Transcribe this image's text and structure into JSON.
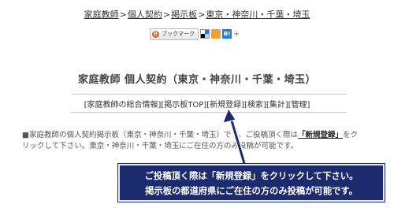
{
  "breadcrumb": {
    "items": [
      "家庭教師",
      "個人契約",
      "掲示板",
      "東京・神奈川・千葉・埼玉"
    ],
    "separator": ">"
  },
  "social": {
    "bookmark_label": "ブックマーク",
    "hatena_label": "B!",
    "plus_label": "+"
  },
  "page": {
    "title": "家庭教師 個人契約（東京・神奈川・千葉・埼玉）"
  },
  "menu": {
    "items": [
      "[家庭教師の総合情報]",
      "[掲示板TOP]",
      "[新規登録]",
      "[検索]",
      "[集計]",
      "[管理]"
    ]
  },
  "description": {
    "line1_pre": "■家庭教師の個人契約掲示板（東京・神奈川・千葉・埼玉）です。ご投稿頂く際は",
    "register_link": "「新規登録」",
    "line1_post": "をク",
    "line2": "リックして下さい。東京・神奈川・千葉・埼玉にご在住の方のみ投稿が可能です。"
  },
  "callout": {
    "line1": "ご投稿頂く際は「新規登録」をクリックして下さい。",
    "line2": "掲示板の都道府県にご在住の方のみ投稿が可能です。"
  },
  "colors": {
    "callout_bg": "#1c2a6e",
    "arrow": "#1c2a6e"
  }
}
